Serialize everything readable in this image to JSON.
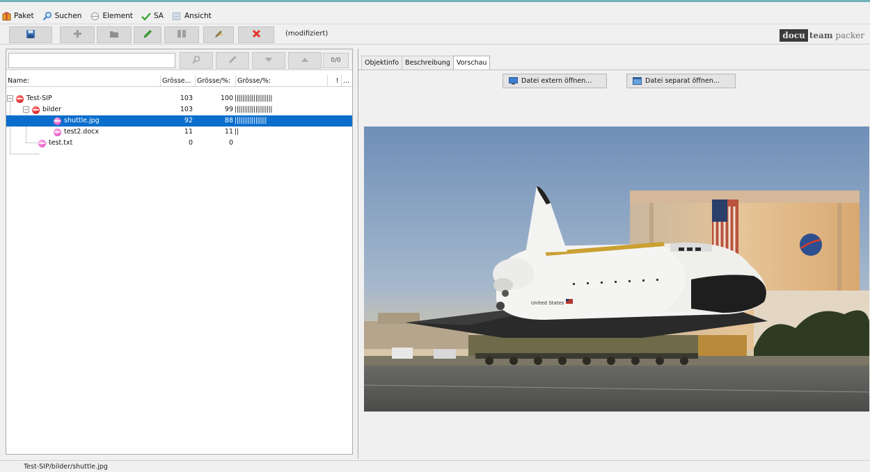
{
  "menu": {
    "paket": "Paket",
    "suchen": "Suchen",
    "element": "Element",
    "sa": "SA",
    "ansicht": "Ansicht"
  },
  "toolbar": {
    "status": "(modifiziert)",
    "logo_docu": "docu",
    "logo_team": "team",
    "logo_packer": " packer"
  },
  "search": {
    "value": "",
    "counter": "0/0"
  },
  "table": {
    "headers": [
      "Name:",
      "Grösse...",
      "Grösse/%:",
      "Grösse/%:",
      "!",
      "..."
    ],
    "rows": [
      {
        "name": "Test-SIP",
        "size": "103",
        "pct": "100",
        "bar": "||||||||||||||||||||"
      },
      {
        "name": "bilder",
        "size": "103",
        "pct": "99",
        "bar": "||||||||||||||||||||"
      },
      {
        "name": "shuttle.jpg",
        "size": "92",
        "pct": "88",
        "bar": "|||||||||||||||||"
      },
      {
        "name": "test2.docx",
        "size": "11",
        "pct": "11",
        "bar": "||"
      },
      {
        "name": "test.txt",
        "size": "0",
        "pct": "0",
        "bar": ""
      }
    ]
  },
  "tabs": [
    "Objektinfo",
    "Beschreibung",
    "Vorschau"
  ],
  "preview": {
    "open_external": "Datei extern öffnen...",
    "open_separate": "Datei separat öffnen...",
    "flag_text": "United States"
  },
  "status": {
    "path": "Test-SIP/bilder/shuttle.jpg"
  },
  "colors": {
    "selection": "#0a6ecd",
    "accent_line": "#6fb3b8",
    "delete_red": "#e8332a",
    "check_green": "#3aa832"
  }
}
